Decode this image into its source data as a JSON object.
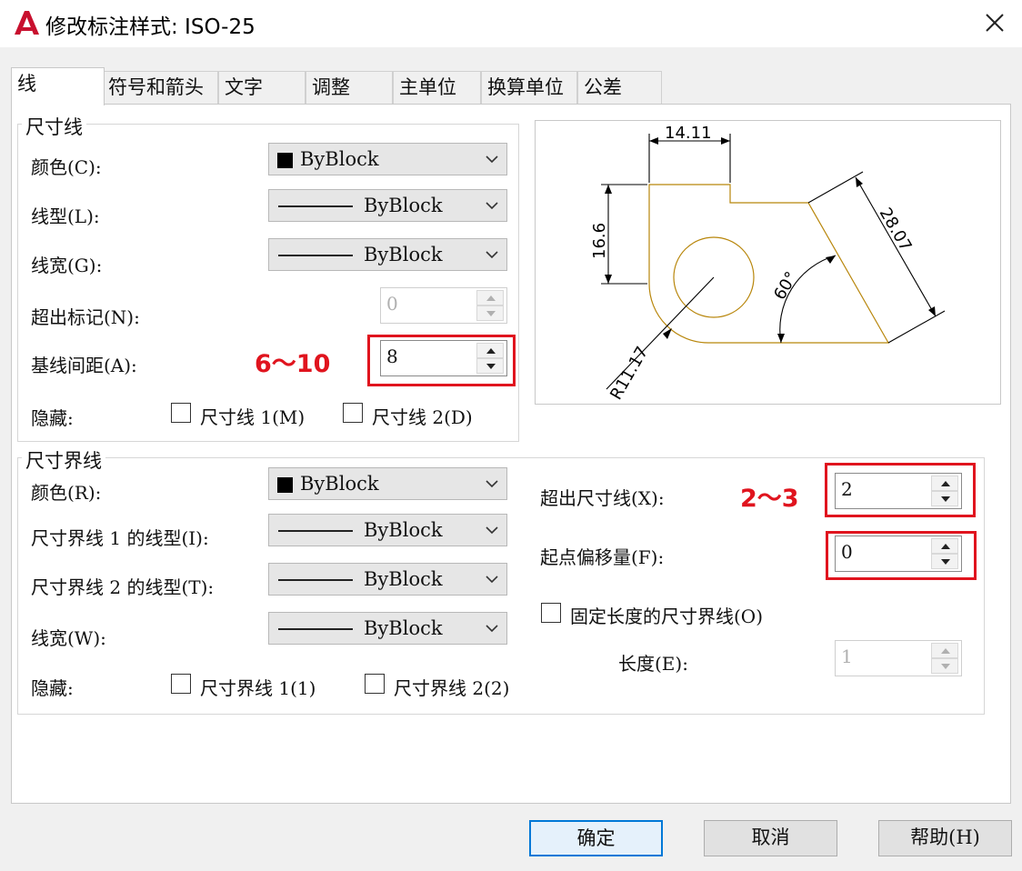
{
  "window": {
    "title": "修改标注样式: ISO-25",
    "close_icon": "close-icon",
    "app_icon": "autocad-a-icon"
  },
  "tabs": [
    {
      "label": "线"
    },
    {
      "label": "符号和箭头"
    },
    {
      "label": "文字"
    },
    {
      "label": "调整"
    },
    {
      "label": "主单位"
    },
    {
      "label": "换算单位"
    },
    {
      "label": "公差"
    }
  ],
  "dim_lines": {
    "legend": "尺寸线",
    "color_label": "颜色(C):",
    "color_value": "ByBlock",
    "linetype_label": "线型(L):",
    "linetype_value": "ByBlock",
    "lineweight_label": "线宽(G):",
    "lineweight_value": "ByBlock",
    "extend_label": "超出标记(N):",
    "extend_value": "0",
    "baseline_label": "基线间距(A):",
    "baseline_value": "8",
    "baseline_note": "6～10",
    "suppress_label": "隐藏:",
    "suppress1": "尺寸线 1(M)",
    "suppress2": "尺寸线 2(D)"
  },
  "ext_lines": {
    "legend": "尺寸界线",
    "color_label": "颜色(R):",
    "color_value": "ByBlock",
    "lt1_label": "尺寸界线 1 的线型(I):",
    "lt1_value": "ByBlock",
    "lt2_label": "尺寸界线 2 的线型(T):",
    "lt2_value": "ByBlock",
    "lineweight_label": "线宽(W):",
    "lineweight_value": "ByBlock",
    "suppress_label": "隐藏:",
    "suppress1": "尺寸界线 1(1)",
    "suppress2": "尺寸界线 2(2)",
    "beyond_label": "超出尺寸线(X):",
    "beyond_value": "2",
    "beyond_note": "2～3",
    "offset_label": "起点偏移量(F):",
    "offset_value": "0",
    "fixed_label": "固定长度的尺寸界线(O)",
    "length_label": "长度(E):",
    "length_value": "1"
  },
  "preview": {
    "dim_top": "14.11",
    "dim_left": "16.6",
    "dim_slant": "28.07",
    "dim_angle": "60°",
    "dim_radius": "R11.17"
  },
  "buttons": {
    "ok": "确定",
    "cancel": "取消",
    "help": "帮助(H)"
  },
  "colors": {
    "accent": "#0078d7",
    "annotation_red": "#e0141e",
    "geometry": "#b8860b"
  }
}
